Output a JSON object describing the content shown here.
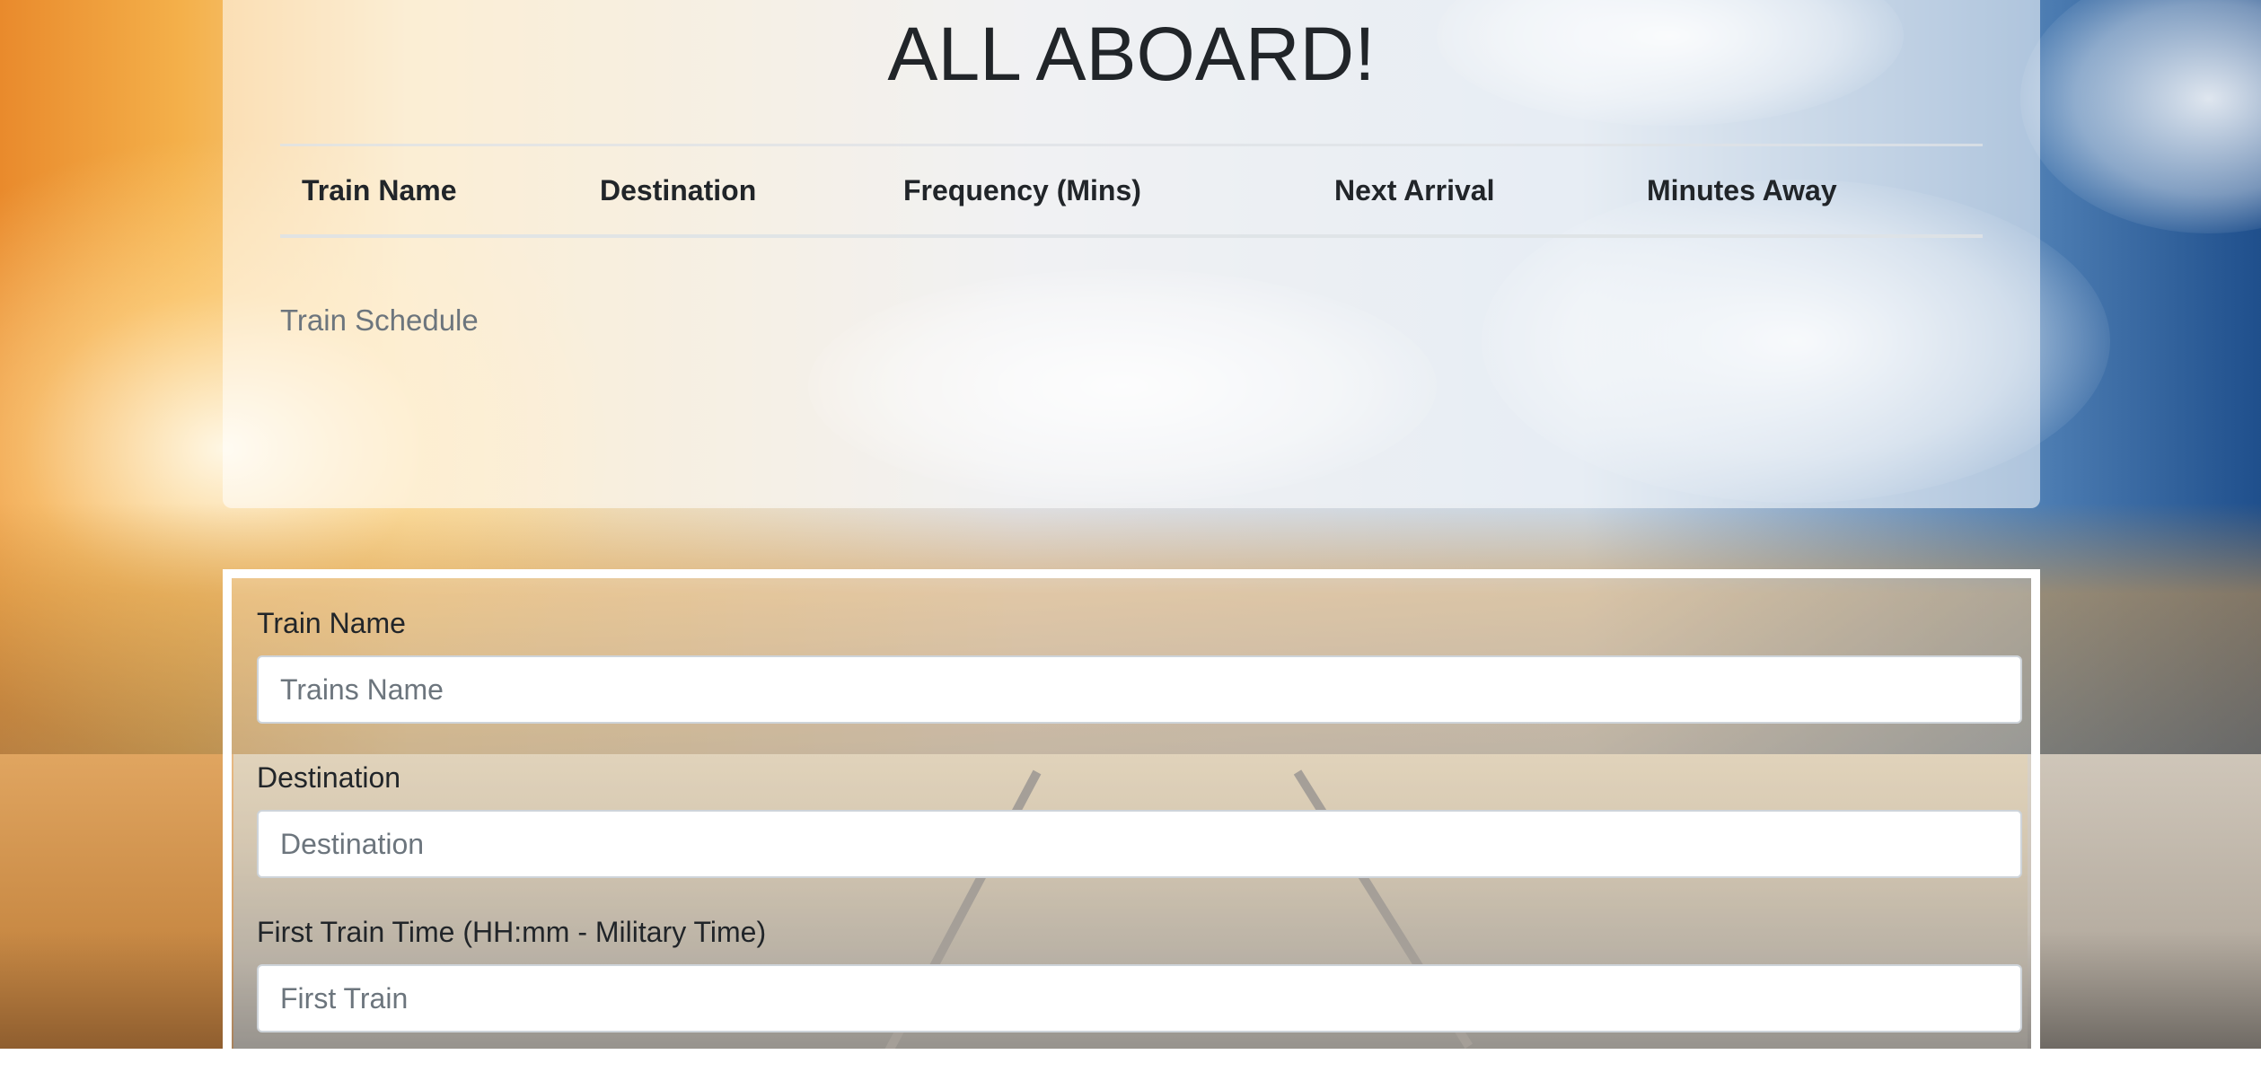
{
  "header": {
    "title": "ALL ABOARD!"
  },
  "schedule": {
    "columns": [
      "Train Name",
      "Destination",
      "Frequency (Mins)",
      "Next Arrival",
      "Minutes Away"
    ],
    "caption": "Train Schedule"
  },
  "form": {
    "train_name": {
      "label": "Train Name",
      "placeholder": "Trains Name"
    },
    "destination": {
      "label": "Destination",
      "placeholder": "Destination"
    },
    "first_train": {
      "label": "First Train Time (HH:mm - Military Time)",
      "placeholder": "First Train"
    }
  }
}
